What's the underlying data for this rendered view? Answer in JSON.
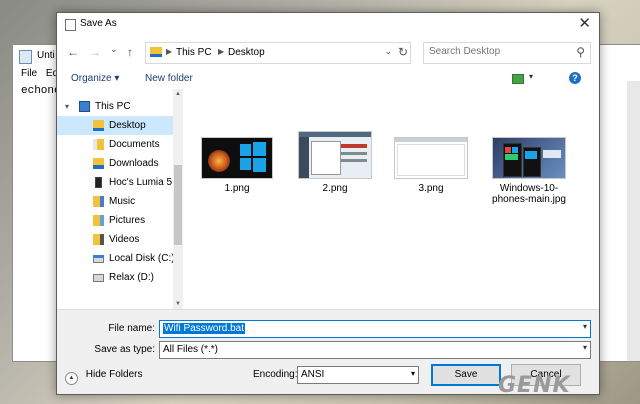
{
  "notepad": {
    "title": "Unti",
    "menu": [
      "File",
      "Ed"
    ],
    "text": "echone"
  },
  "dialog": {
    "title": "Save As",
    "close_glyph": "✕"
  },
  "address": {
    "back_glyph": "←",
    "forward_glyph": "→",
    "recent_glyph": "⌄",
    "up_glyph": "↑",
    "crumbs": [
      "This PC",
      "Desktop"
    ],
    "sep_glyph": "▶",
    "dropdown_glyph": "⌄",
    "refresh_glyph": "↻"
  },
  "search": {
    "placeholder": "Search Desktop",
    "icon_glyph": "⚲"
  },
  "toolbar": {
    "organize_label": "Organize",
    "organize_glyph": "▾",
    "new_folder_label": "New folder",
    "view_dd_glyph": "▾",
    "help_glyph": "?"
  },
  "nav": {
    "items": [
      {
        "label": "This PC",
        "icon": "computer-icon"
      },
      {
        "label": "Desktop",
        "icon": "desktop-folder-icon"
      },
      {
        "label": "Documents",
        "icon": "documents-folder-icon"
      },
      {
        "label": "Downloads",
        "icon": "downloads-folder-icon"
      },
      {
        "label": "Hoc's Lumia 5",
        "icon": "phone-icon"
      },
      {
        "label": "Music",
        "icon": "music-folder-icon"
      },
      {
        "label": "Pictures",
        "icon": "pictures-folder-icon"
      },
      {
        "label": "Videos",
        "icon": "videos-folder-icon"
      },
      {
        "label": "Local Disk (C:)",
        "icon": "drive-icon"
      },
      {
        "label": "Relax (D:)",
        "icon": "drive-icon"
      }
    ],
    "expand_glyph": "▾",
    "scroll_up_glyph": "▲",
    "scroll_down_glyph": "▼"
  },
  "files": [
    {
      "name": "1.png"
    },
    {
      "name": "2.png"
    },
    {
      "name": "3.png"
    },
    {
      "name": "Windows-10-phones-main.jpg"
    }
  ],
  "form": {
    "filename_label": "File name:",
    "filename_value": "Wifi Password.bat",
    "savetype_label": "Save as type:",
    "savetype_value": "All Files  (*.*)",
    "dd_glyph": "▾"
  },
  "footer": {
    "hide_folders_label": "Hide Folders",
    "hide_glyph": "▲",
    "encoding_label": "Encoding:",
    "encoding_value": "ANSI",
    "dd_glyph": "▾",
    "save_label": "Save",
    "cancel_label": "Cancel"
  },
  "watermark": "GENK"
}
